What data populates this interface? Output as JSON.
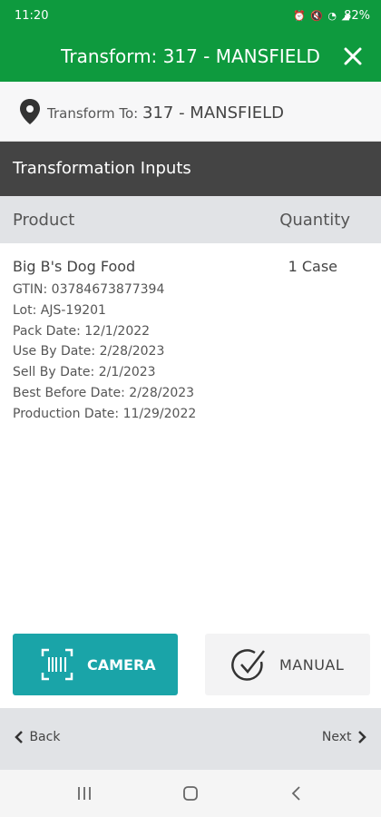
{
  "status_bar": {
    "time": "11:20",
    "battery": "82%"
  },
  "header": {
    "title": "Transform: 317 - MANSFIELD",
    "close_icon": "close-icon"
  },
  "destination": {
    "label": "Transform To:",
    "value": "317 - MANSFIELD",
    "icon": "location-pin-icon"
  },
  "section": {
    "title": "Transformation Inputs"
  },
  "table": {
    "columns": [
      "Product",
      "Quantity"
    ],
    "rows": [
      {
        "product": "Big B's Dog Food",
        "quantity": "1 Case",
        "details": [
          "GTIN: 03784673877394",
          "Lot: AJS-19201",
          "Pack Date: 12/1/2022",
          "Use By Date: 2/28/2023",
          "Sell By Date: 2/1/2023",
          "Best Before Date: 2/28/2023",
          "Production Date: 11/29/2022"
        ]
      }
    ]
  },
  "actions": {
    "camera_label": "CAMERA",
    "manual_label": "MANUAL"
  },
  "nav": {
    "back_label": "Back",
    "next_label": "Next"
  },
  "colors": {
    "brand_green": "#0e9a3e",
    "camera_teal": "#1aa4a8",
    "section_dark": "#444444"
  }
}
